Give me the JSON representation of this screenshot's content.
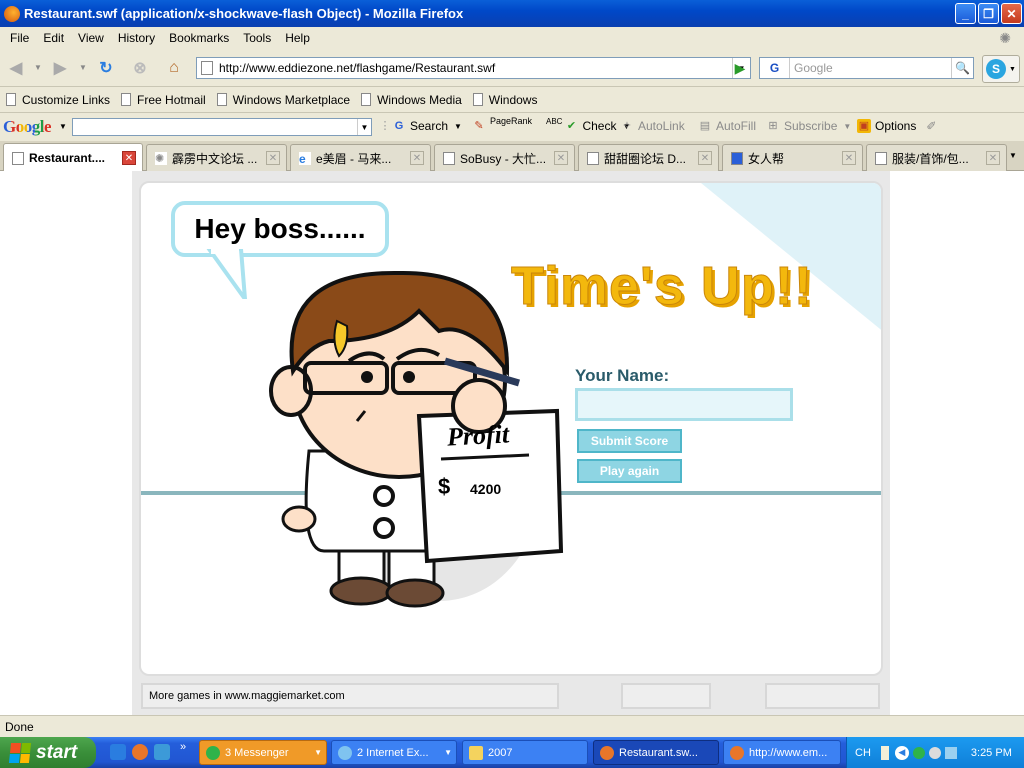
{
  "window": {
    "title": "Restaurant.swf (application/x-shockwave-flash Object) - Mozilla Firefox"
  },
  "menubar": {
    "items": [
      "File",
      "Edit",
      "View",
      "History",
      "Bookmarks",
      "Tools",
      "Help"
    ]
  },
  "navbar": {
    "url": "http://www.eddiezone.net/flashgame/Restaurant.swf",
    "search_placeholder": "Google",
    "search_engine": "G"
  },
  "bookmarks": {
    "items": [
      "Customize Links",
      "Free Hotmail",
      "Windows Marketplace",
      "Windows Media",
      "Windows"
    ]
  },
  "google_toolbar": {
    "logo": "Google",
    "search": "Search",
    "pagerank": "PageRank",
    "check_abc": "ABC",
    "check": "Check",
    "autolink": "AutoLink",
    "autofill": "AutoFill",
    "subscribe": "Subscribe",
    "options": "Options"
  },
  "tabs": [
    {
      "label": "Restaurant....",
      "active": true
    },
    {
      "label": "霹雳中文论坛 ...",
      "active": false
    },
    {
      "label": "e美眉 - 马来...",
      "active": false
    },
    {
      "label": "SoBusy - 大忙...",
      "active": false
    },
    {
      "label": "甜甜圈论坛 D...",
      "active": false
    },
    {
      "label": "女人帮",
      "active": false
    },
    {
      "label": "服装/首饰/包...",
      "active": false
    }
  ],
  "game": {
    "speech": "Hey boss......",
    "headline": "Time's Up!!",
    "name_label": "Your Name:",
    "name_value": "",
    "submit_label": "Submit Score",
    "play_label": "Play again",
    "profit_heading": "Profit",
    "currency": "$",
    "profit_value": "4200",
    "footer_text": "More games in www.maggiemarket.com"
  },
  "status": {
    "text": "Done"
  },
  "taskbar": {
    "start": "start",
    "tasks": [
      "3 Messenger",
      "2 Internet Ex...",
      "2007",
      "Restaurant.sw...",
      "http://www.em..."
    ],
    "tray_lang": "CH",
    "clock": "3:25 PM"
  },
  "colors": {
    "titlebar": "#0048c8",
    "accent_cyan": "#8ed5e3",
    "headline_yellow": "#f3b80d",
    "taskbar": "#245edb"
  }
}
